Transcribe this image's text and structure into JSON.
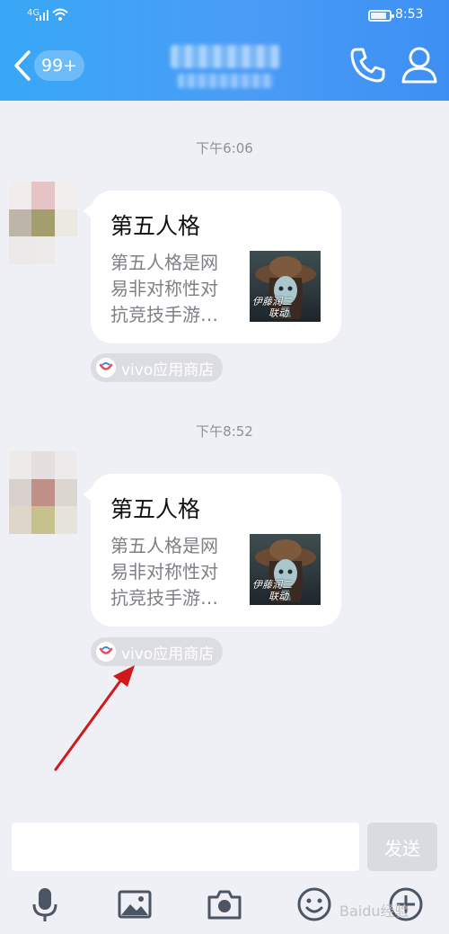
{
  "status_bar": {
    "network": "4G",
    "time": "8:53",
    "battery_level": 0.85
  },
  "header": {
    "unread_count": "99+"
  },
  "conversation": [
    {
      "timestamp": "下午6:06",
      "card": {
        "title": "第五人格",
        "desc_lines": [
          "第五人格是网",
          "易非对称性对",
          "抗竞技手游…"
        ],
        "thumb_caption": [
          "伊藤润二",
          "联动"
        ]
      },
      "source": "vivo应用商店"
    },
    {
      "timestamp": "下午8:52",
      "card": {
        "title": "第五人格",
        "desc_lines": [
          "第五人格是网",
          "易非对称性对",
          "抗竞技手游…"
        ],
        "thumb_caption": [
          "伊藤润二",
          "联动"
        ]
      },
      "source": "vivo应用商店"
    }
  ],
  "input": {
    "send_label": "发送"
  },
  "watermark": "Baidu经验",
  "colors": {
    "header_start": "#38a8f6",
    "header_end": "#3d8ff3",
    "arrow": "#d0191c",
    "background": "#eef0f5"
  },
  "toolbar_icons": [
    "microphone-icon",
    "image-icon",
    "camera-icon",
    "emoji-icon",
    "more-icon"
  ]
}
